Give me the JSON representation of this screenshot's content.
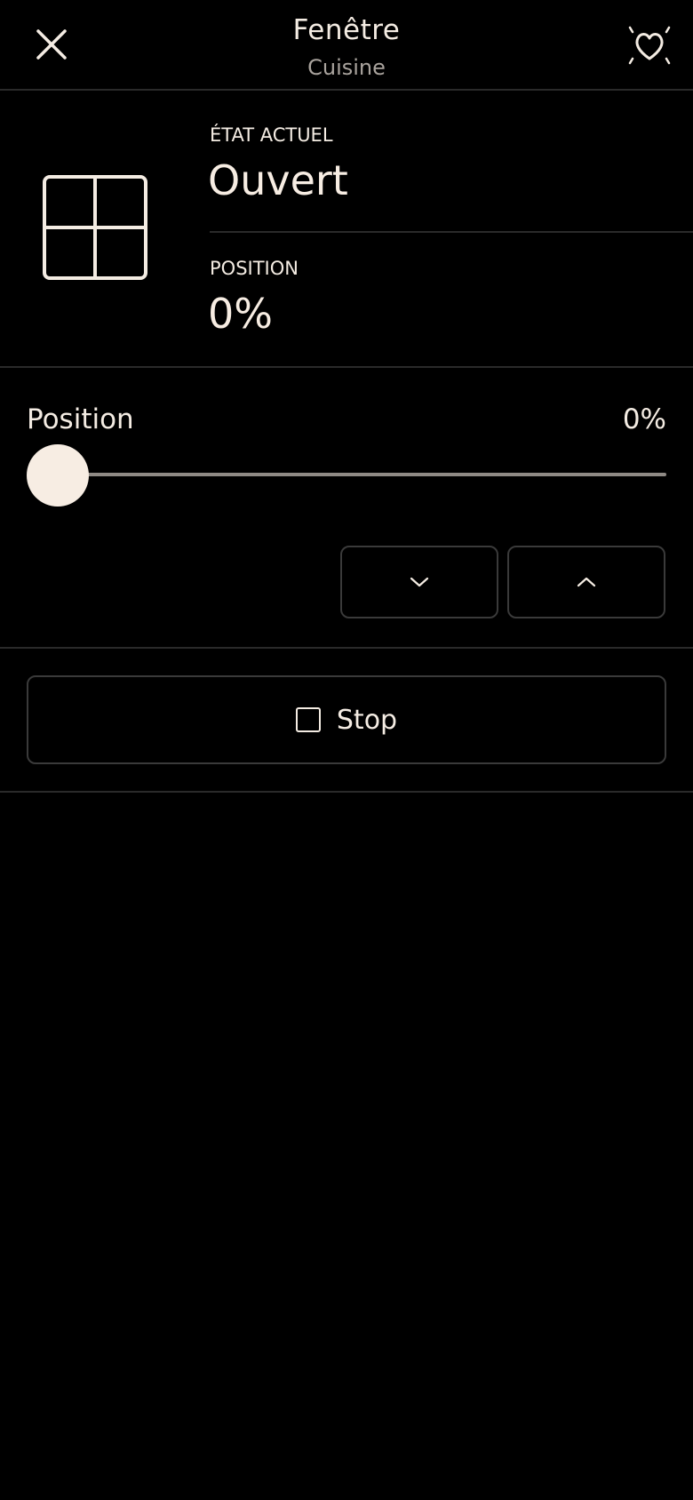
{
  "header": {
    "title": "Fenêtre",
    "subtitle": "Cuisine",
    "close_icon": "close-icon",
    "favorite_icon": "heart-icon"
  },
  "status": {
    "device_icon": "window-icon",
    "state_label": "ÉTAT ACTUEL",
    "state_value": "Ouvert",
    "position_label": "POSITION",
    "position_value": "0%"
  },
  "slider": {
    "label": "Position",
    "readout": "0%",
    "value_fraction": 0,
    "down_icon": "chevron-down-icon",
    "up_icon": "chevron-up-icon"
  },
  "stop": {
    "label": "Stop",
    "icon": "stop-square-icon"
  },
  "colors": {
    "background": "#000000",
    "text": "#f7ede3",
    "muted_text": "#a9a39d",
    "divider": "#2a2a2a",
    "track": "#8f8a85"
  }
}
